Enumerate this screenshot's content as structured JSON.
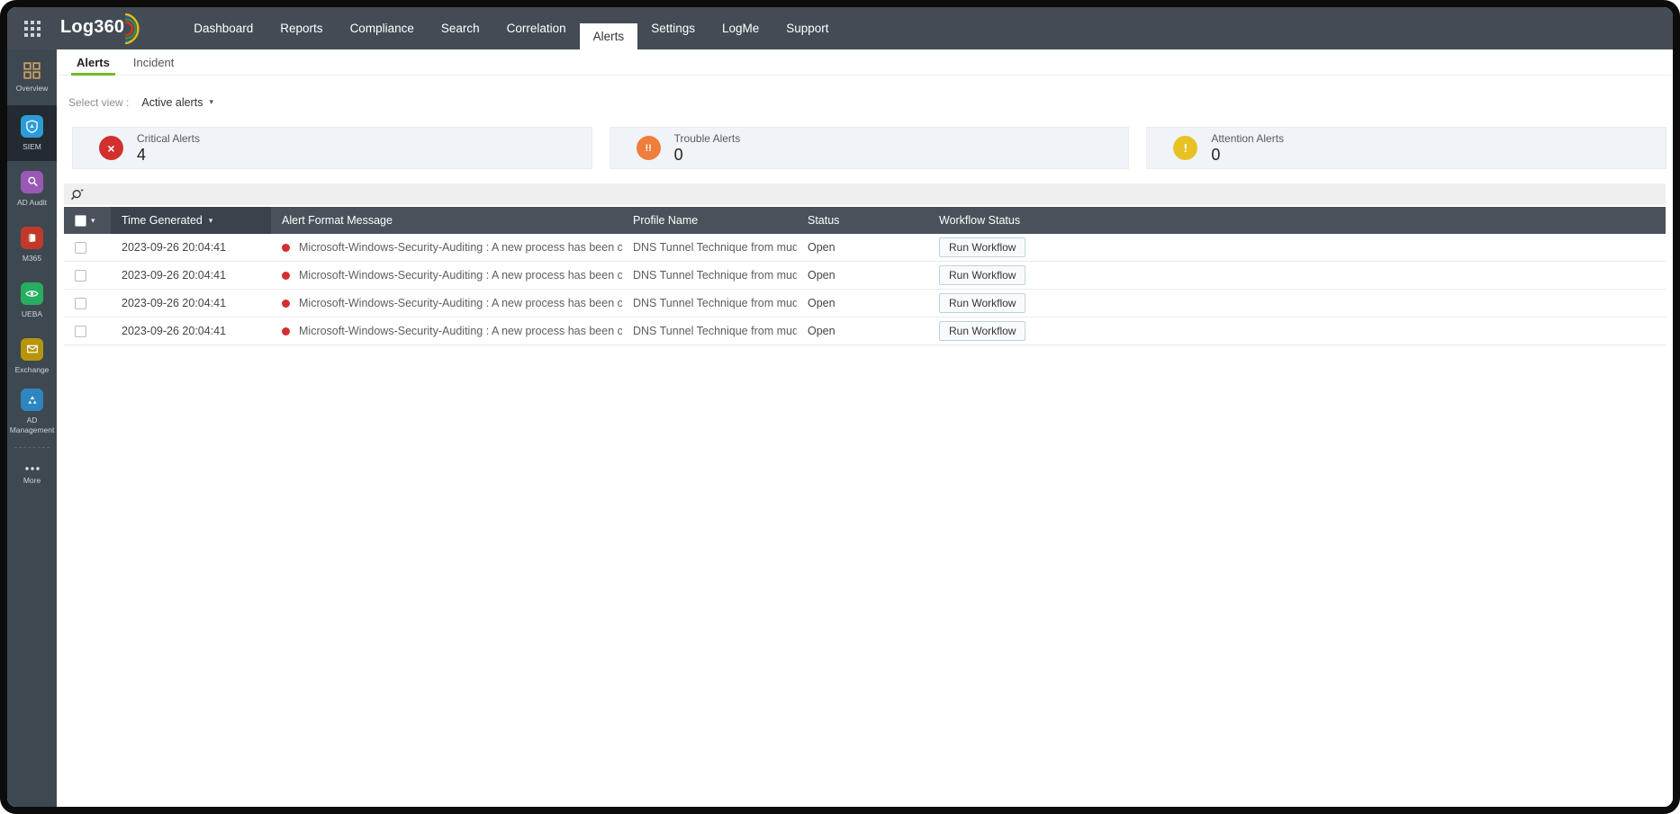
{
  "colors": {
    "topbar_bg": "#434c54",
    "sidebar_bg": "#3e4850",
    "sidebar_active_bg": "#232b31",
    "accent_green": "#76b82a",
    "critical_red": "#d22f2f",
    "trouble_orange": "#ef7d3b",
    "attention_yellow": "#e9c125",
    "card_bg": "#f0f4f8",
    "header_bg": "#49525a",
    "header_sorted_bg": "#3a434b",
    "severity_dot": "#d32f2f",
    "overview_icon": "#c89f62",
    "siem_icon": "#2b9cd8",
    "ad_audit_icon": "#9b59b6",
    "m365_icon": "#c0392b",
    "ueba_icon": "#27ae60",
    "exchange_icon": "#b7950b",
    "ad_mgmt_icon": "#2e86c1"
  },
  "topbar": {
    "logo_text": "Log360",
    "nav": [
      {
        "label": "Dashboard",
        "active": false
      },
      {
        "label": "Reports",
        "active": false
      },
      {
        "label": "Compliance",
        "active": false
      },
      {
        "label": "Search",
        "active": false
      },
      {
        "label": "Correlation",
        "active": false
      },
      {
        "label": "Alerts",
        "active": true
      },
      {
        "label": "Settings",
        "active": false
      },
      {
        "label": "LogMe",
        "active": false
      },
      {
        "label": "Support",
        "active": false
      }
    ]
  },
  "sidebar": {
    "items": [
      {
        "label": "Overview",
        "icon": "overview-grid-icon",
        "active": false
      },
      {
        "label": "SIEM",
        "icon": "siem-shield-icon",
        "active": true
      },
      {
        "label": "AD Audit",
        "icon": "ad-audit-magnifier-icon",
        "active": false
      },
      {
        "label": "M365",
        "icon": "m365-icon",
        "active": false
      },
      {
        "label": "UEBA",
        "icon": "ueba-eye-icon",
        "active": false
      },
      {
        "label": "Exchange",
        "icon": "exchange-mail-icon",
        "active": false
      },
      {
        "label": "AD Management",
        "icon": "ad-management-icon",
        "active": false
      },
      {
        "label": "More",
        "icon": "more-dots-icon",
        "active": false
      }
    ]
  },
  "subtabs": [
    {
      "label": "Alerts",
      "active": true
    },
    {
      "label": "Incident",
      "active": false
    }
  ],
  "view_selector": {
    "label": "Select view :",
    "value": "Active alerts"
  },
  "summary_cards": [
    {
      "title": "Critical Alerts",
      "value": "4",
      "icon": "critical-x-icon",
      "glyph": "×"
    },
    {
      "title": "Trouble Alerts",
      "value": "0",
      "icon": "trouble-double-exclamation-icon",
      "glyph": "!!"
    },
    {
      "title": "Attention Alerts",
      "value": "0",
      "icon": "attention-exclamation-icon",
      "glyph": "!"
    }
  ],
  "alerts_table": {
    "search_value": "",
    "sorted_column": "Time Generated",
    "columns": [
      "Time Generated",
      "Alert Format Message",
      "Profile Name",
      "Status",
      "Workflow Status"
    ],
    "rows": [
      {
        "time_generated": "2023-09-26 20:04:41",
        "alert_format_message": "Microsoft-Windows-Security-Auditing : A new process has been crea...",
        "profile_name": "DNS Tunnel Technique from mud...",
        "status": "Open",
        "workflow_action": "Run Workflow"
      },
      {
        "time_generated": "2023-09-26 20:04:41",
        "alert_format_message": "Microsoft-Windows-Security-Auditing : A new process has been crea...",
        "profile_name": "DNS Tunnel Technique from mud...",
        "status": "Open",
        "workflow_action": "Run Workflow"
      },
      {
        "time_generated": "2023-09-26 20:04:41",
        "alert_format_message": "Microsoft-Windows-Security-Auditing : A new process has been crea...",
        "profile_name": "DNS Tunnel Technique from mud...",
        "status": "Open",
        "workflow_action": "Run Workflow"
      },
      {
        "time_generated": "2023-09-26 20:04:41",
        "alert_format_message": "Microsoft-Windows-Security-Auditing : A new process has been crea...",
        "profile_name": "DNS Tunnel Technique from mud...",
        "status": "Open",
        "workflow_action": "Run Workflow"
      }
    ]
  },
  "icons": {
    "caret_down": "▾"
  }
}
